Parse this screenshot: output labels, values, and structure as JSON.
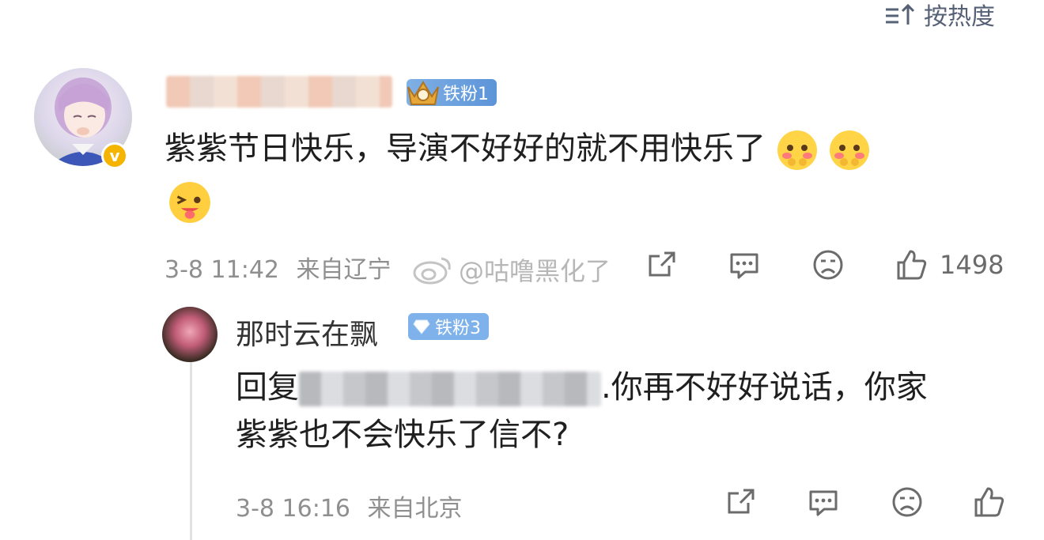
{
  "sort": {
    "label": "按热度",
    "icon": "sort-icon"
  },
  "comment": {
    "badge": "铁粉1",
    "text": "紫紫节日快乐，导演不好好的就不用快乐了",
    "time": "3-8 11:42",
    "location": "来自辽宁",
    "like_count": "1498"
  },
  "watermark": "@咕噜黑化了",
  "reply": {
    "username": "那时云在飘",
    "badge": "铁粉3",
    "prefix": "回复",
    "text_line1": ".你再不好好说话，你家",
    "text_line2": "紫紫也不会快乐了信不?",
    "time": "3-8 16:16",
    "location": "来自北京"
  },
  "colors": {
    "badge_blue": "#5d94d8",
    "verified_gold": "#f5b400",
    "meta_gray": "#8f8f8f"
  }
}
